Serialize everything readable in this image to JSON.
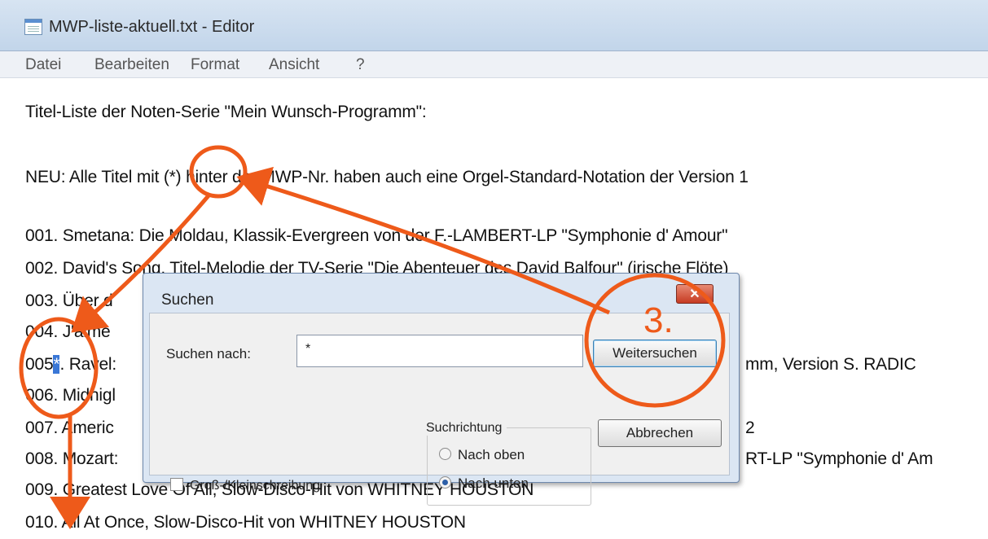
{
  "window": {
    "title": "MWP-liste-aktuell.txt - Editor"
  },
  "menu": [
    "Datei",
    "Bearbeiten",
    "Format",
    "Ansicht",
    "?"
  ],
  "editor": {
    "lines": [
      "Titel-Liste der Noten-Serie \"Mein Wunsch-Programm\":",
      "NEU: Alle Titel mit (*) hinter der MWP-Nr. haben auch eine Orgel-Standard-Notation der Version 1",
      "001. Smetana: Die Moldau, Klassik-Evergreen von der F.-LAMBERT-LP \"Symphonie d' Amour\"",
      "002. David's Song, Titel-Melodie der TV-Serie \"Die Abenteuer des David Balfour\" (irische Flöte)",
      "003. Über d",
      "004. J'aime",
      "005",
      "*",
      ". Ravel:",
      "mm, Version S. RADIC",
      "006. Midnigl",
      "007. Americ",
      "2",
      "008. Mozart:",
      "RT-LP \"Symphonie d' Am",
      "009. Greatest Love Of All, Slow-Disco-Hit von WHITNEY HOUSTON",
      "010. All At Once, Slow-Disco-Hit von WHITNEY HOUSTON"
    ]
  },
  "dialog": {
    "title": "Suchen",
    "close_glyph": "✕",
    "find_label": "Suchen nach:",
    "find_value": "*",
    "find_next": "Weitersuchen",
    "cancel": "Abbrechen",
    "direction_label": "Suchrichtung",
    "up": "Nach oben",
    "down": "Nach unten",
    "match_case": "Groß-/Kleinschreibung"
  },
  "annotation": {
    "step": "3.",
    "color": "#ee5a1a"
  }
}
